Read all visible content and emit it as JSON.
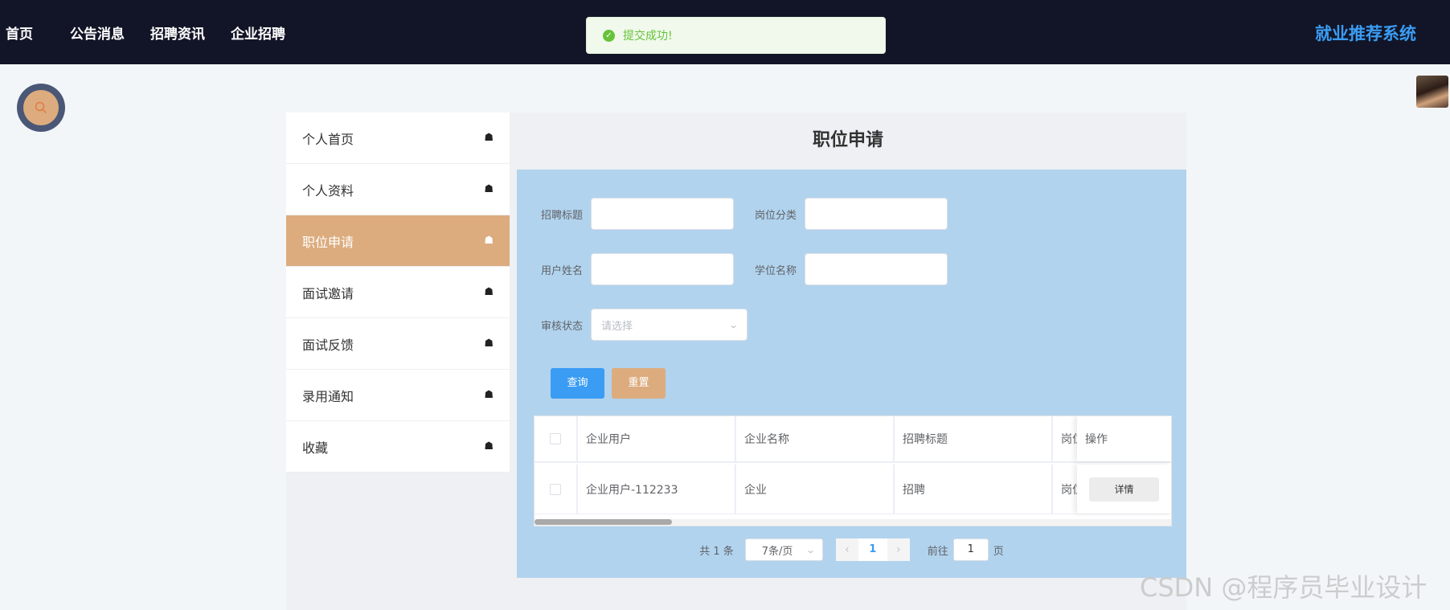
{
  "nav": {
    "items": [
      "首页",
      "公告消息",
      "招聘资讯",
      "企业招聘"
    ],
    "brand": "就业推荐系统"
  },
  "toast": {
    "message": "提交成功!",
    "color": "#67c23a"
  },
  "sidebar": {
    "items": [
      {
        "label": "个人首页",
        "active": false
      },
      {
        "label": "个人资料",
        "active": false
      },
      {
        "label": "职位申请",
        "active": true
      },
      {
        "label": "面试邀请",
        "active": false
      },
      {
        "label": "面试反馈",
        "active": false
      },
      {
        "label": "录用通知",
        "active": false
      },
      {
        "label": "收藏",
        "active": false
      }
    ],
    "icon": "home-icon"
  },
  "main": {
    "title": "职位申请",
    "form": {
      "recruit_title_label": "招聘标题",
      "recruit_title_value": "",
      "position_category_label": "岗位分类",
      "position_category_value": "",
      "user_name_label": "用户姓名",
      "user_name_value": "",
      "degree_name_label": "学位名称",
      "degree_name_value": "",
      "review_status_label": "审核状态",
      "review_status_placeholder": "请选择"
    },
    "buttons": {
      "query": "查询",
      "reset": "重置"
    },
    "table": {
      "headers": [
        "企业用户",
        "企业名称",
        "招聘标题",
        "岗位",
        "操作"
      ],
      "rows": [
        {
          "company_user": "企业用户-112233",
          "company_name": "企业",
          "recruit_title": "招聘",
          "position": "岗位",
          "action": "详情"
        }
      ]
    },
    "pagination": {
      "total": "共 1 条",
      "page_size": "7条/页",
      "current_page": "1",
      "goto_label": "前往",
      "goto_value": "1",
      "page_suffix": "页"
    }
  },
  "watermark": "CSDN @程序员毕业设计",
  "colors": {
    "accent": "#3a9cf3",
    "active": "#dcac7e",
    "topbar": "#121527",
    "content_bg": "#b1d3ee"
  }
}
